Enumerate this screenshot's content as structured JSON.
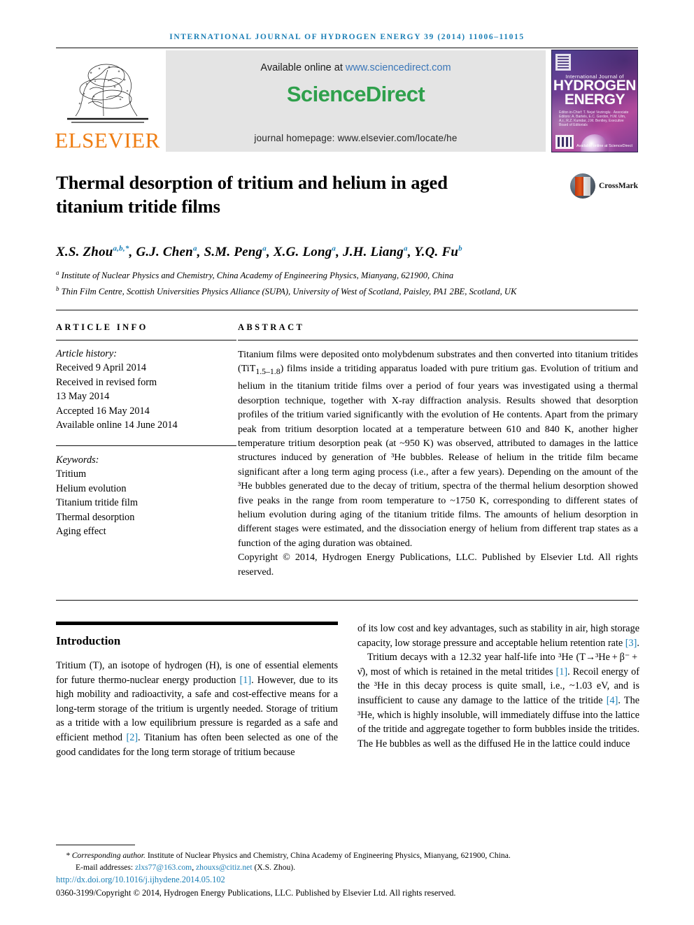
{
  "running_head": "International Journal of Hydrogen Energy 39 (2014) 11006–11015",
  "banner": {
    "publisher": "ELSEVIER",
    "available_prefix": "Available online at ",
    "available_url": "www.sciencedirect.com",
    "sciencedirect_logo": "ScienceDirect",
    "journal_homepage": "journal homepage: www.elsevier.com/locate/he",
    "cover": {
      "small_line": "International Journal of",
      "big_line_1": "HYDROGEN",
      "big_line_2": "ENERGY",
      "editors": "Editor-in-Chief: T. Nejat Veziroglu · Associate Editors: A. Bartels, E.C. Gordon, H.M. Ulm, A.r., R.Z. Kumdar, J.M. Bentley, Executive Board of Editorials",
      "sciencedirect_mark": "Available online at ScienceDirect"
    },
    "crossmark_label": "CrossMark"
  },
  "title": "Thermal desorption of tritium and helium in aged titanium tritide films",
  "authors": [
    {
      "name": "X.S. Zhou",
      "sup": "a,b,*"
    },
    {
      "name": "G.J. Chen",
      "sup": "a"
    },
    {
      "name": "S.M. Peng",
      "sup": "a"
    },
    {
      "name": "X.G. Long",
      "sup": "a"
    },
    {
      "name": "J.H. Liang",
      "sup": "a"
    },
    {
      "name": "Y.Q. Fu",
      "sup": "b"
    }
  ],
  "affiliations": [
    {
      "marker": "a",
      "text": "Institute of Nuclear Physics and Chemistry, China Academy of Engineering Physics, Mianyang, 621900, China"
    },
    {
      "marker": "b",
      "text": "Thin Film Centre, Scottish Universities Physics Alliance (SUPA), University of West of Scotland, Paisley, PA1 2BE, Scotland, UK"
    }
  ],
  "article_info": {
    "heading": "ARTICLE INFO",
    "history_label": "Article history:",
    "history": [
      "Received 9 April 2014",
      "Received in revised form",
      "13 May 2014",
      "Accepted 16 May 2014",
      "Available online 14 June 2014"
    ],
    "keywords_label": "Keywords:",
    "keywords": [
      "Tritium",
      "Helium evolution",
      "Titanium tritide film",
      "Thermal desorption",
      "Aging effect"
    ]
  },
  "abstract": {
    "heading": "ABSTRACT",
    "part1": "Titanium films were deposited onto molybdenum substrates and then converted into titanium tritides (TiT",
    "subscript": "1.5–1.8",
    "part2": ") films inside a tritiding apparatus loaded with pure tritium gas. Evolution of tritium and helium in the titanium tritide films over a period of four years was investigated using a thermal desorption technique, together with X-ray diffraction analysis. Results showed that desorption profiles of the tritium varied significantly with the evolution of He contents. Apart from the primary peak from tritium desorption located at a temperature between 610 and 840 K, another higher temperature tritium desorption peak (at ~950 K) was observed, attributed to damages in the lattice structures induced by generation of ³He bubbles. Release of helium in the tritide film became significant after a long term aging process (i.e., after a few years). Depending on the amount of the ³He bubbles generated due to the decay of tritium, spectra of the thermal helium desorption showed five peaks in the range from room temperature to ~1750 K, corresponding to different states of helium evolution during aging of the titanium tritide films. The amounts of helium desorption in different stages were estimated, and the dissociation energy of helium from different trap states as a function of the aging duration was obtained.",
    "copyright": "Copyright © 2014, Hydrogen Energy Publications, LLC. Published by Elsevier Ltd. All rights reserved."
  },
  "body": {
    "intro_heading": "Introduction",
    "left_p1_a": "Tritium (T), an isotope of hydrogen (H), is one of essential elements for future thermo-nuclear energy production ",
    "left_ref1": "[1]",
    "left_p1_b": ". However, due to its high mobility and radioactivity, a safe and cost-effective means for a long-term storage of the tritium is urgently needed. Storage of tritium as a tritide with a low equilibrium pressure is regarded as a safe and efficient method ",
    "left_ref2": "[2]",
    "left_p1_c": ". Titanium has often been selected as one of the good candidates for the long term storage of tritium because",
    "right_p1_a": "of its low cost and key advantages, such as stability in air, high storage capacity, low storage pressure and acceptable helium retention rate ",
    "right_ref3": "[3]",
    "right_p1_b": ".",
    "right_p2_a": "Tritium decays with a 12.32 year half-life into ³He (T→³He + β⁻ + ν̄), most of which is retained in the metal tritides ",
    "right_ref1": "[1]",
    "right_p2_b": ". Recoil energy of the ³He in this decay process is quite small, i.e., ~1.03 eV, and is insufficient to cause any damage to the lattice of the tritide ",
    "right_ref4": "[4]",
    "right_p2_c": ". The ³He, which is highly insoluble, will immediately diffuse into the lattice of the tritide and aggregate together to form bubbles inside the tritides. The He bubbles as well as the diffused He in the lattice could induce"
  },
  "footer": {
    "corresponding_marker": "*",
    "corresponding_label": "Corresponding author.",
    "corresponding_text": " Institute of Nuclear Physics and Chemistry, China Academy of Engineering Physics, Mianyang, 621900, China.",
    "email_label": "E-mail addresses: ",
    "email1": "zlxs77@163.com",
    "email_sep": ", ",
    "email2": "zhouxs@citiz.net",
    "email_suffix": " (X.S. Zhou).",
    "doi": "http://dx.doi.org/10.1016/j.ijhydene.2014.05.102",
    "issn_line": "0360-3199/Copyright © 2014, Hydrogen Energy Publications, LLC. Published by Elsevier Ltd. All rights reserved."
  },
  "colors": {
    "link_blue": "#1a7eb5",
    "elsevier_orange": "#ef7d12",
    "sciencedirect_green": "#2fa04c"
  }
}
